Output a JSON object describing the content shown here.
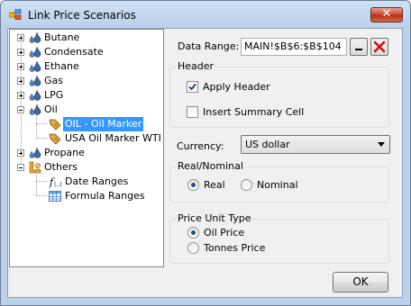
{
  "window": {
    "title": "Link Price Scenarios",
    "close_glyph": "✕"
  },
  "tree": {
    "items": [
      {
        "label": "Butane",
        "icon": "oil-drop-icon"
      },
      {
        "label": "Condensate",
        "icon": "oil-drop-icon"
      },
      {
        "label": "Ethane",
        "icon": "oil-drop-icon"
      },
      {
        "label": "Gas",
        "icon": "oil-drop-icon"
      },
      {
        "label": "LPG",
        "icon": "oil-drop-icon"
      },
      {
        "label": "Oil",
        "icon": "oil-drop-icon",
        "children": [
          {
            "label": "OIL - Oil Marker",
            "selected": true,
            "icon": "price-tag-icon"
          },
          {
            "label": "USA Oil Marker WTI",
            "icon": "price-tag-icon"
          }
        ]
      },
      {
        "label": "Propane",
        "icon": "oil-drop-icon"
      },
      {
        "label": "Others",
        "icon": "others-icon",
        "children": [
          {
            "label": "Date Ranges",
            "icon": "function-icon"
          },
          {
            "label": "Formula Ranges",
            "icon": "grid-icon"
          }
        ]
      }
    ]
  },
  "form": {
    "data_range_label": "Data Range:",
    "data_range_value": "MAIN!$B$6:$B$104",
    "header_group": "Header",
    "apply_header": "Apply Header",
    "apply_header_checked": true,
    "insert_summary": "Insert Summary Cell",
    "insert_summary_checked": false,
    "currency_label": "Currency:",
    "currency_value": "US dollar",
    "real_nominal_group": "Real/Nominal",
    "real": "Real",
    "nominal": "Nominal",
    "real_selected": true,
    "price_unit_group": "Price Unit Type",
    "oil_price": "Oil Price",
    "tonnes_price": "Tonnes Price",
    "oil_price_selected": true,
    "ok": "OK"
  },
  "colors": {
    "selection": "#3399ff",
    "close_red": "#c7452c",
    "clear_x": "#cc1111"
  }
}
